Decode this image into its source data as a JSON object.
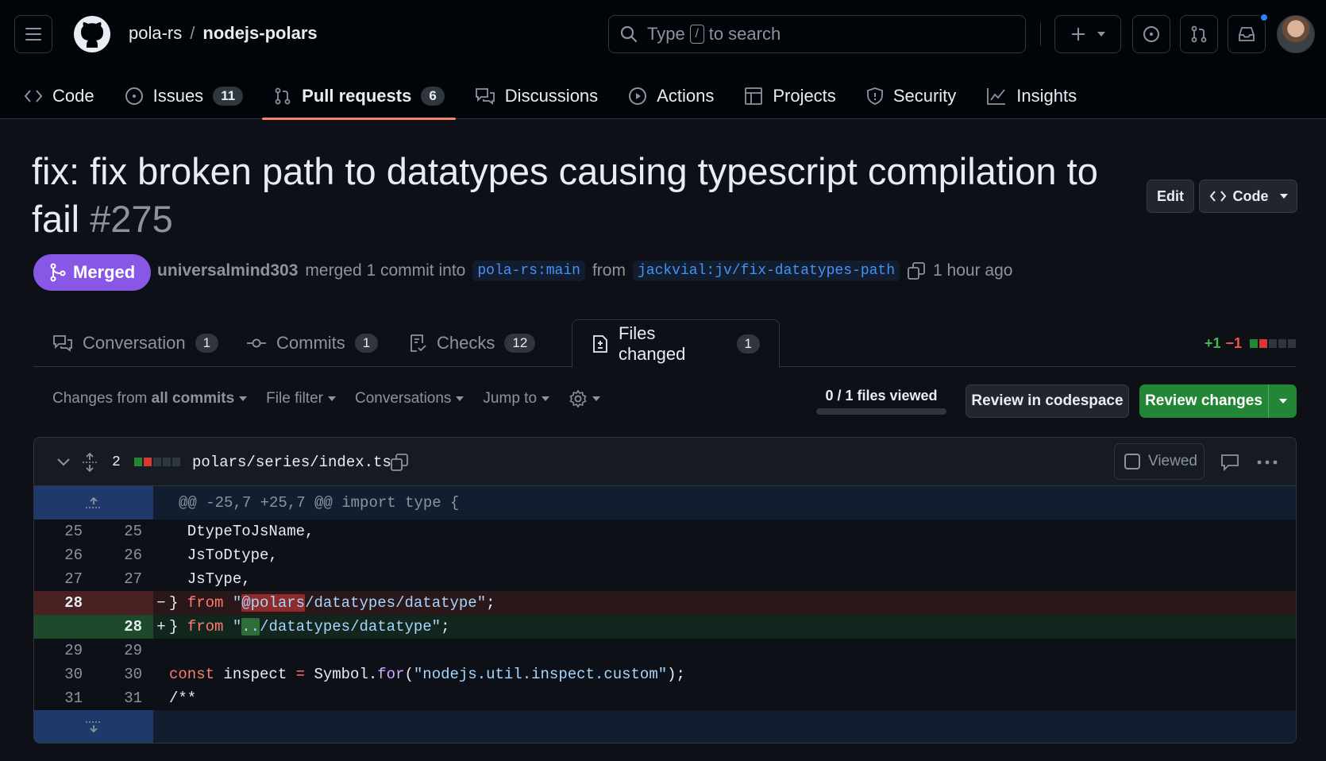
{
  "header": {
    "owner": "pola-rs",
    "separator": "/",
    "repo": "nodejs-polars",
    "search": {
      "prefix": "Type",
      "key": "/",
      "suffix": "to search"
    }
  },
  "repo_nav": [
    {
      "label": "Code",
      "icon": "code-icon",
      "count": null,
      "active": false
    },
    {
      "label": "Issues",
      "icon": "issue-opened-icon",
      "count": "11",
      "active": false
    },
    {
      "label": "Pull requests",
      "icon": "git-pull-request-icon",
      "count": "6",
      "active": true
    },
    {
      "label": "Discussions",
      "icon": "comment-discussion-icon",
      "count": null,
      "active": false
    },
    {
      "label": "Actions",
      "icon": "play-icon",
      "count": null,
      "active": false
    },
    {
      "label": "Projects",
      "icon": "table-icon",
      "count": null,
      "active": false
    },
    {
      "label": "Security",
      "icon": "shield-icon",
      "count": null,
      "active": false
    },
    {
      "label": "Insights",
      "icon": "graph-icon",
      "count": null,
      "active": false
    }
  ],
  "pr": {
    "title": "fix: fix broken path to datatypes causing typescript compilation to fail",
    "number": "#275",
    "edit_label": "Edit",
    "code_label": "Code",
    "state": "Merged",
    "author": "universalmind303",
    "action_text": "merged 1 commit into",
    "base_branch": "pola-rs:main",
    "from_text": "from",
    "head_branch": "jackvial:jv/fix-datatypes-path",
    "time": "1 hour ago"
  },
  "tabs": [
    {
      "label": "Conversation",
      "count": "1",
      "icon": "comment-discussion-icon"
    },
    {
      "label": "Commits",
      "count": "1",
      "icon": "git-commit-icon"
    },
    {
      "label": "Checks",
      "count": "12",
      "icon": "checklist-icon"
    },
    {
      "label": "Files changed",
      "count": "1",
      "icon": "file-diff-icon"
    }
  ],
  "diffstat": {
    "additions": "+1",
    "deletions": "−1"
  },
  "toolbar": {
    "changes_prefix": "Changes from",
    "changes_value": "all commits",
    "file_filter": "File filter",
    "conversations": "Conversations",
    "jump_to": "Jump to",
    "files_viewed": "0 / 1 files viewed",
    "files_viewed_fraction": 0,
    "review_codespace": "Review in codespace",
    "review_changes": "Review changes"
  },
  "file": {
    "changes": "2",
    "path": "polars/series/index.ts",
    "viewed_label": "Viewed",
    "hunk_header": "@@ -25,7 +25,7 @@ import type {",
    "lines": [
      {
        "old": "25",
        "new": "25",
        "type": "ctx",
        "text": "  DtypeToJsName,"
      },
      {
        "old": "26",
        "new": "26",
        "type": "ctx",
        "text": "  JsToDtype,"
      },
      {
        "old": "27",
        "new": "27",
        "type": "ctx",
        "text": "  JsType,"
      },
      {
        "old": "28",
        "new": "",
        "type": "del",
        "sign": "−",
        "pre": "} ",
        "kw": "from",
        "q1": " \"",
        "hl": "@polars",
        "rest": "/datatypes/datatype\"",
        "end": ";"
      },
      {
        "old": "",
        "new": "28",
        "type": "add",
        "sign": "+",
        "pre": "} ",
        "kw": "from",
        "q1": " \"",
        "hl": "..",
        "rest": "/datatypes/datatype\"",
        "end": ";"
      },
      {
        "old": "29",
        "new": "29",
        "type": "ctx",
        "text": ""
      },
      {
        "old": "30",
        "new": "30",
        "type": "code30"
      },
      {
        "old": "31",
        "new": "31",
        "type": "comment",
        "text": "/**"
      }
    ],
    "line30": {
      "kw": "const",
      "ident": " inspect ",
      "op": "=",
      "obj": " Symbol.",
      "fn": "for",
      "open": "(",
      "str": "\"nodejs.util.inspect.custom\"",
      "close": ");"
    }
  }
}
